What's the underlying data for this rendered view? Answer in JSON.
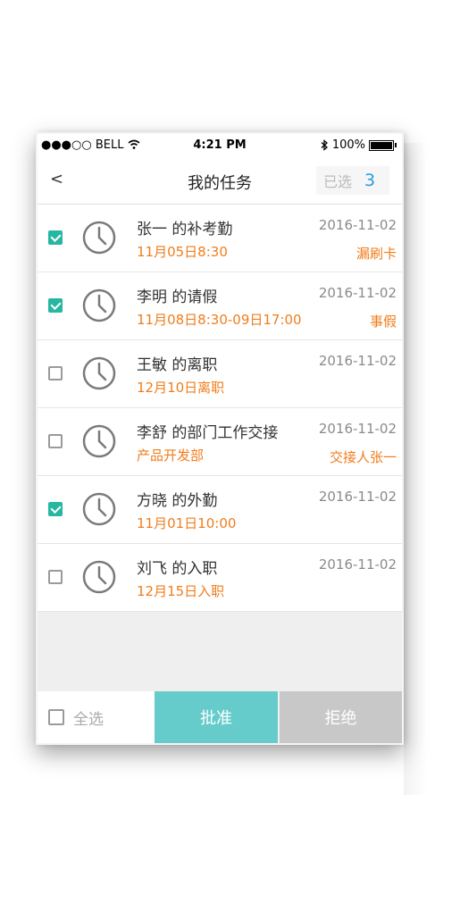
{
  "status_bar": {
    "carrier": "●●●○○ BELL",
    "wifi_icon": "wifi-icon",
    "time": "4:21 PM",
    "bluetooth_icon": "bluetooth-icon",
    "battery": "100%"
  },
  "nav": {
    "back": "<",
    "title": "我的任务",
    "selected_label": "已选",
    "selected_count": "3"
  },
  "tasks": [
    {
      "checked": true,
      "title": "张一  的补考勤",
      "subtitle": "11月05日8:30",
      "date": "2016-11-02",
      "tag": "漏刷卡"
    },
    {
      "checked": true,
      "title": "李明  的请假",
      "subtitle": "11月08日8:30-09日17:00",
      "date": "2016-11-02",
      "tag": "事假"
    },
    {
      "checked": false,
      "title": "王敏  的离职",
      "subtitle": "12月10日离职",
      "date": "2016-11-02",
      "tag": ""
    },
    {
      "checked": false,
      "title": "李舒  的部门工作交接",
      "subtitle": "产品开发部",
      "date": "2016-11-02",
      "tag": "交接人张一"
    },
    {
      "checked": true,
      "title": "方晓  的外勤",
      "subtitle": "11月01日10:00",
      "date": "2016-11-02",
      "tag": ""
    },
    {
      "checked": false,
      "title": "刘飞  的入职",
      "subtitle": "12月15日入职",
      "date": "2016-11-02",
      "tag": ""
    }
  ],
  "bottom_bar": {
    "select_all": "全选",
    "approve": "批准",
    "reject": "拒绝"
  },
  "colors": {
    "accent_teal": "#27b7a0",
    "approve_bg": "#66cccb",
    "reject_bg": "#c8c8c8",
    "orange_text": "#f07d1c",
    "count_blue": "#2a9be0"
  }
}
